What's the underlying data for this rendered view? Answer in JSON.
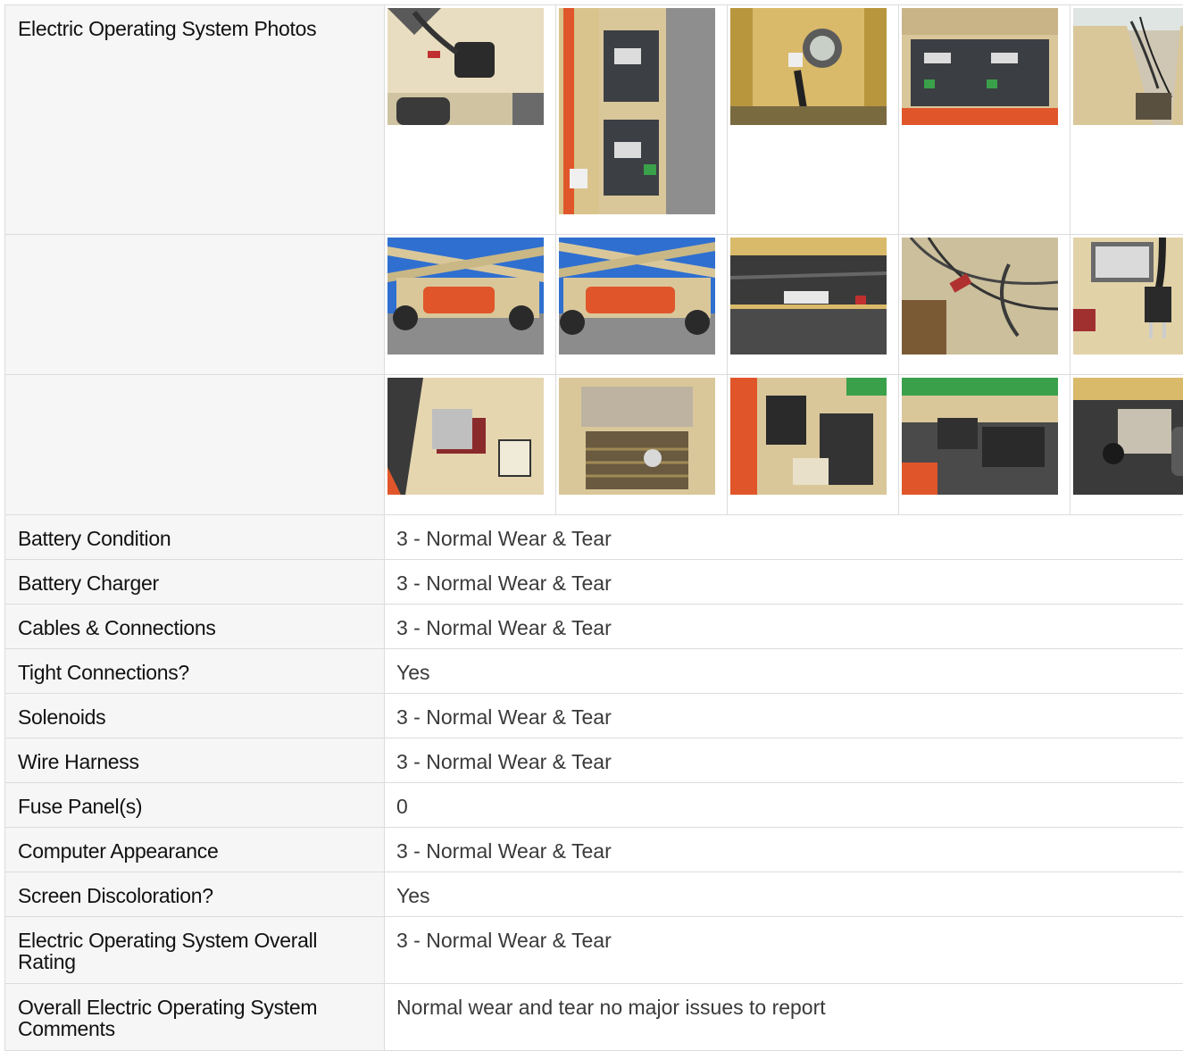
{
  "section": {
    "photos_label": "Electric Operating System Photos"
  },
  "photos": {
    "row1": [
      {
        "icon": "battery-connector-photo"
      },
      {
        "icon": "battery-tray-photo"
      },
      {
        "icon": "battery-meter-photo"
      },
      {
        "icon": "battery-compartment-photo"
      },
      {
        "icon": "compartment-wiring-photo"
      }
    ],
    "row2": [
      {
        "icon": "scissor-lift-side-photo"
      },
      {
        "icon": "scissor-lift-front-photo"
      },
      {
        "icon": "motor-cables-photo"
      },
      {
        "icon": "wire-bundle-photo"
      },
      {
        "icon": "charger-plug-photo"
      }
    ],
    "row3": [
      {
        "icon": "disconnect-switch-photo"
      },
      {
        "icon": "battery-bay-photo"
      },
      {
        "icon": "control-panel-photo"
      },
      {
        "icon": "solenoid-assembly-photo"
      },
      {
        "icon": "motor-assembly-photo"
      }
    ]
  },
  "fields": [
    {
      "label": "Battery Condition",
      "value": "3 - Normal Wear & Tear"
    },
    {
      "label": "Battery Charger",
      "value": "3 - Normal Wear & Tear"
    },
    {
      "label": "Cables & Connections",
      "value": "3 - Normal Wear & Tear"
    },
    {
      "label": "Tight Connections?",
      "value": "Yes"
    },
    {
      "label": "Solenoids",
      "value": "3 - Normal Wear & Tear"
    },
    {
      "label": "Wire Harness",
      "value": "3 - Normal Wear & Tear"
    },
    {
      "label": "Fuse Panel(s)",
      "value": "0"
    },
    {
      "label": "Computer Appearance",
      "value": "3 - Normal Wear & Tear"
    },
    {
      "label": "Screen Discoloration?",
      "value": "Yes"
    },
    {
      "label": "Electric Operating System Overall Rating",
      "value": "3 - Normal Wear & Tear"
    },
    {
      "label": "Overall Electric Operating System Comments",
      "value": "Normal wear and tear no major issues to report"
    }
  ],
  "colors": {
    "label_bg": "#f6f6f6",
    "border": "#dcdcdc",
    "label_text": "#111111",
    "value_text": "#3a3a3a",
    "machine_tan": "#d9c79a",
    "machine_orange": "#e0562a",
    "sky_blue": "#2f6fd0",
    "asphalt": "#8c8c8c"
  }
}
